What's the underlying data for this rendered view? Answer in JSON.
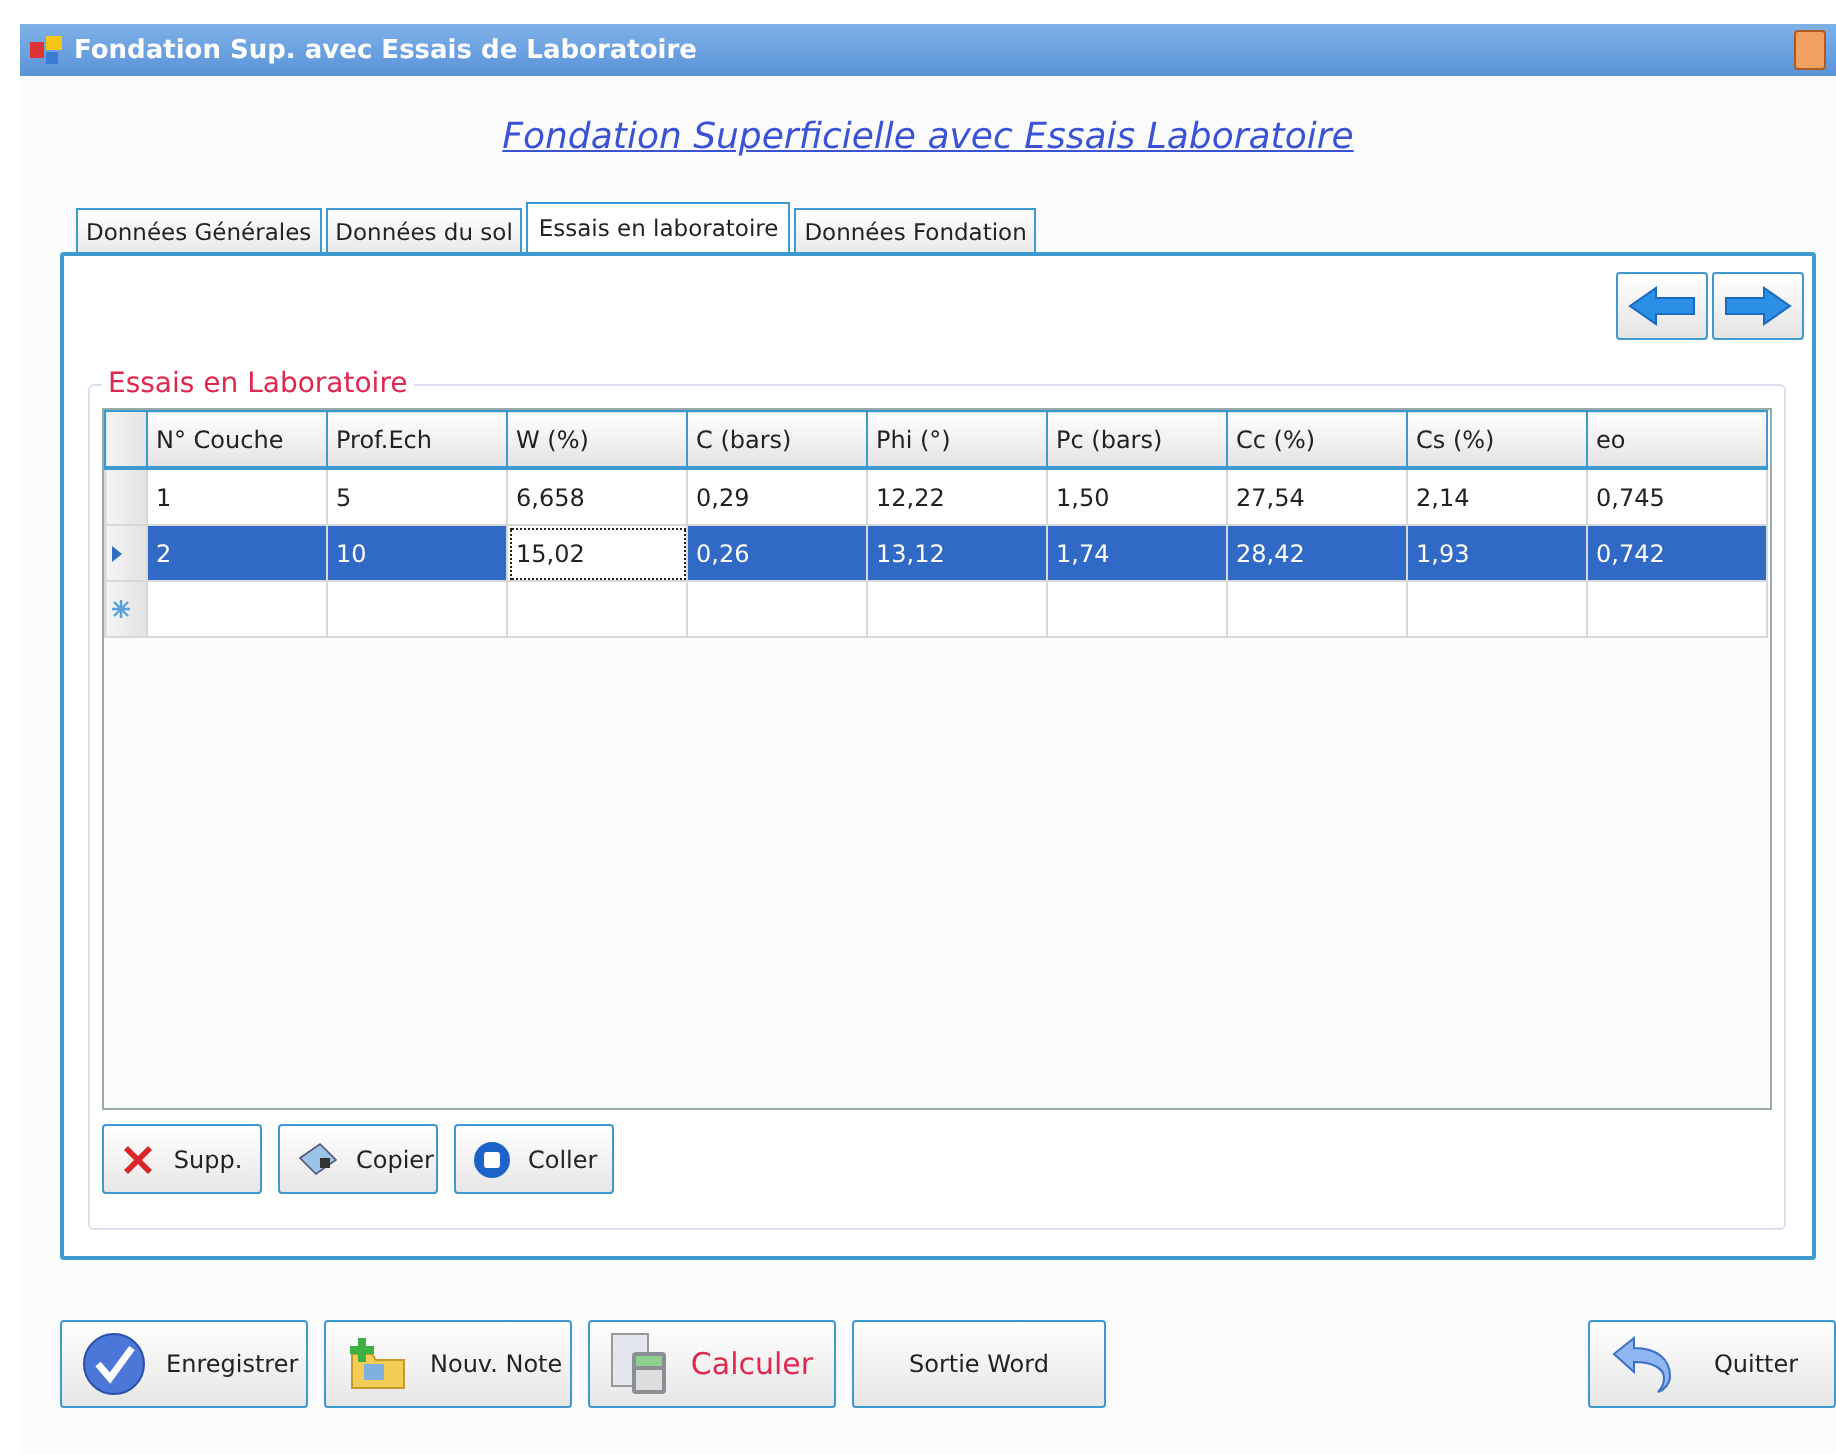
{
  "window": {
    "title": "Fondation Sup. avec Essais de Laboratoire"
  },
  "heading": "Fondation Superficielle avec Essais Laboratoire",
  "tabs": [
    {
      "label": "Données Générales",
      "selected": false
    },
    {
      "label": "Données du sol",
      "selected": false
    },
    {
      "label": "Essais en laboratoire",
      "selected": true
    },
    {
      "label": "Données Fondation",
      "selected": false
    }
  ],
  "group": {
    "title": "Essais en Laboratoire"
  },
  "table": {
    "columns": [
      "N° Couche",
      "Prof.Ech",
      "W (%)",
      "C (bars)",
      "Phi (°)",
      "Pc (bars)",
      "Cc (%)",
      "Cs (%)",
      "eo"
    ],
    "rows": [
      {
        "selected": false,
        "cells": [
          {
            "text": "1",
            "focused": false
          },
          {
            "text": "5",
            "focused": false
          },
          {
            "text": "6,658",
            "focused": false
          },
          {
            "text": "0,29",
            "focused": false
          },
          {
            "text": "12,22",
            "focused": false
          },
          {
            "text": "1,50",
            "focused": false
          },
          {
            "text": "27,54",
            "focused": false
          },
          {
            "text": "2,14",
            "focused": false
          },
          {
            "text": "0,745",
            "focused": false
          }
        ]
      },
      {
        "selected": true,
        "cells": [
          {
            "text": "2",
            "focused": false
          },
          {
            "text": "10",
            "focused": false
          },
          {
            "text": "15,02",
            "focused": true
          },
          {
            "text": "0,26",
            "focused": false
          },
          {
            "text": "13,12",
            "focused": false
          },
          {
            "text": "1,74",
            "focused": false
          },
          {
            "text": "28,42",
            "focused": false
          },
          {
            "text": "1,93",
            "focused": false
          },
          {
            "text": "0,742",
            "focused": false
          }
        ]
      }
    ],
    "new_row": true
  },
  "grid_buttons": [
    {
      "label": "Supp.",
      "kind": "delete"
    },
    {
      "label": "Copier",
      "kind": "copy"
    },
    {
      "label": "Coller",
      "kind": "paste"
    }
  ],
  "buttons": [
    {
      "label": "Enregistrer",
      "kind": "save"
    },
    {
      "label": "Nouv. Note",
      "kind": "new"
    },
    {
      "label": "Calculer",
      "kind": "calculate"
    },
    {
      "label": "Sortie Word",
      "kind": "plain"
    },
    {
      "label": "Quitter",
      "kind": "quit"
    }
  ]
}
